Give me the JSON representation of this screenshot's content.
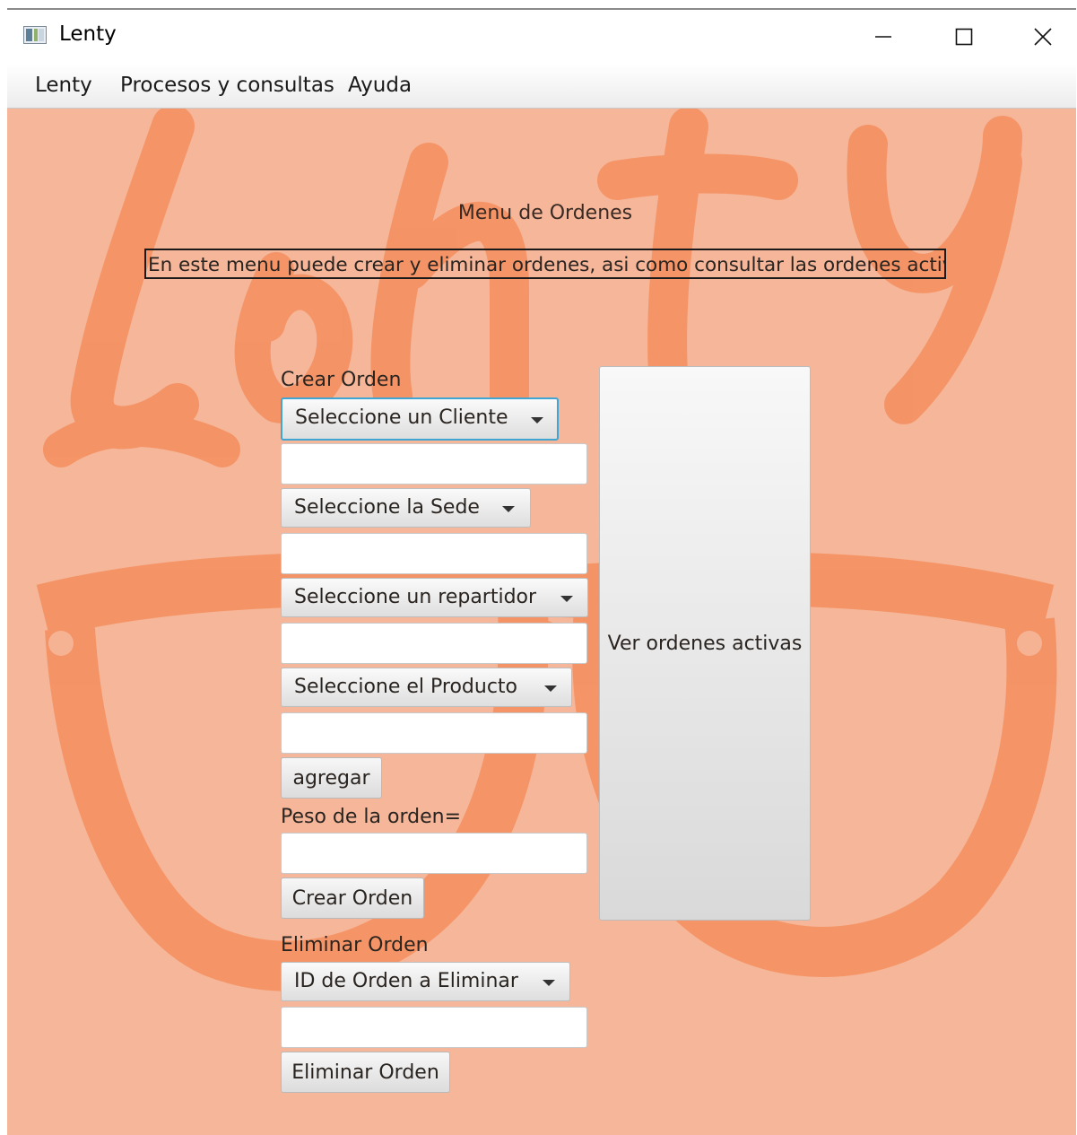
{
  "window": {
    "title": "Lenty",
    "icon": "app-window-icon",
    "controls": [
      "minimize-icon",
      "maximize-icon",
      "close-icon"
    ]
  },
  "menubar": {
    "items": [
      "Lenty",
      "Procesos y consultas",
      "Ayuda"
    ]
  },
  "background": {
    "color": "#f5b699",
    "art_color": "#f48f5e"
  },
  "main": {
    "heading": "Menu de Ordenes",
    "description": "En este menu puede crear y eliminar ordenes, asi como consultar las ordenes activas",
    "create_section_label": "Crear Orden",
    "client_combo": "Seleccione un Cliente",
    "client_field": "",
    "sede_combo": "Seleccione la Sede",
    "sede_field": "",
    "repartidor_combo": "Seleccione un repartidor",
    "repartidor_field": "",
    "producto_combo": "Seleccione el Producto",
    "producto_field": "",
    "agregar_button": "agregar",
    "peso_label": "Peso de la orden=",
    "peso_field": "",
    "crear_button": "Crear Orden",
    "delete_section_label": "Eliminar Orden",
    "delete_combo": "ID de Orden a Eliminar",
    "delete_field": "",
    "eliminar_button": "Eliminar Orden",
    "ver_button": "Ver ordenes activas"
  }
}
